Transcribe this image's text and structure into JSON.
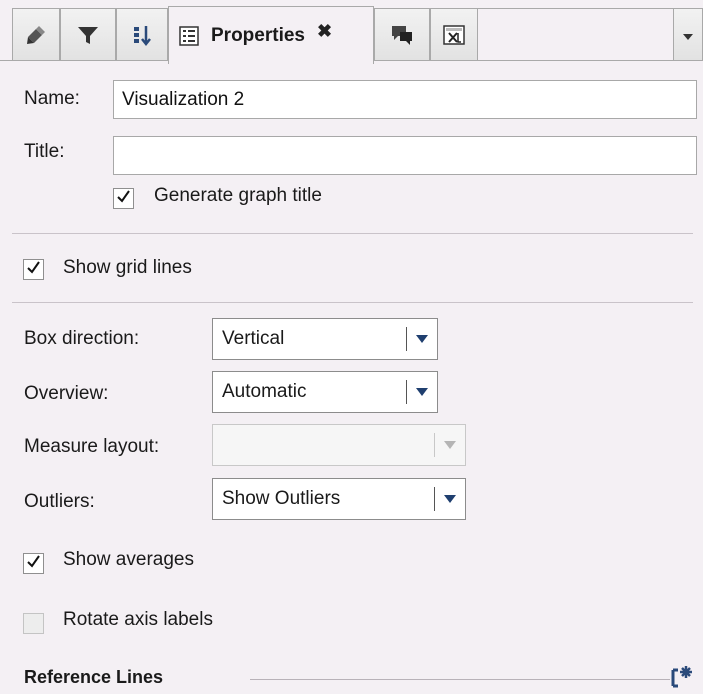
{
  "tabs": {
    "active_label": "Properties",
    "icons": [
      "edit-icon",
      "filter-icon",
      "sort-icon",
      "properties-icon",
      "comments-icon",
      "excel-icon"
    ],
    "close_glyph": "✖"
  },
  "name": {
    "label": "Name:",
    "value": "Visualization 2"
  },
  "title": {
    "label": "Title:",
    "value": ""
  },
  "generate_title": {
    "label": "Generate graph title",
    "checked": true
  },
  "show_grid": {
    "label": "Show grid lines",
    "checked": true
  },
  "box_direction": {
    "label": "Box direction:",
    "value": "Vertical"
  },
  "overview": {
    "label": "Overview:",
    "value": "Automatic"
  },
  "measure_layout": {
    "label": "Measure layout:",
    "value": ""
  },
  "outliers": {
    "label": "Outliers:",
    "value": "Show Outliers"
  },
  "show_averages": {
    "label": "Show averages",
    "checked": true
  },
  "rotate_axis": {
    "label": "Rotate axis labels",
    "checked": false
  },
  "reference_lines": {
    "label": "Reference Lines"
  }
}
